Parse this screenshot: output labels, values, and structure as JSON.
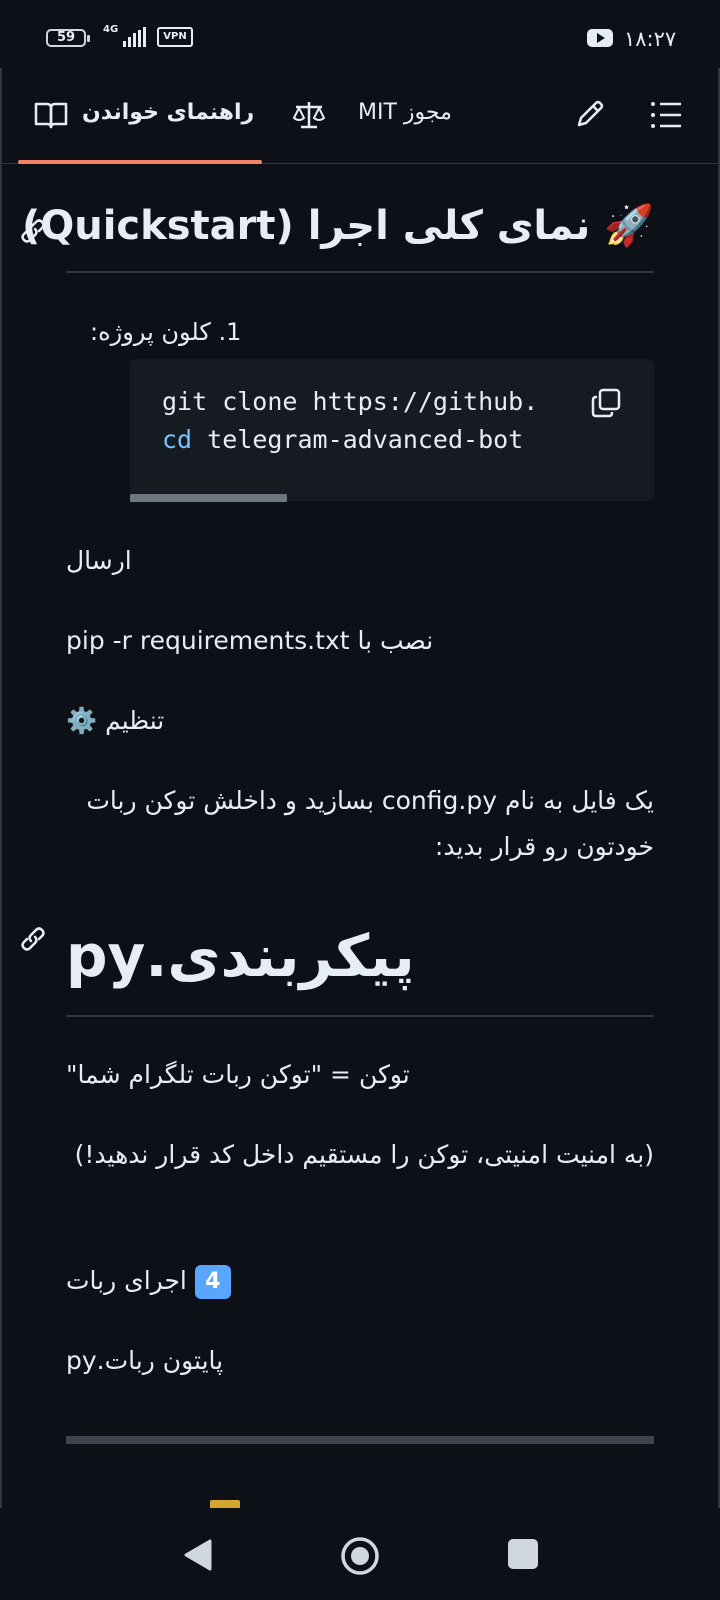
{
  "status_bar": {
    "battery": "59",
    "network": "4G",
    "vpn": "VPN",
    "time": "۱۸:۲۷"
  },
  "tabs": [
    {
      "label": "راهنمای خواندن",
      "icon": "book-icon",
      "active": true
    },
    {
      "label": "مجوز MIT",
      "icon": "scale-icon",
      "active": false
    }
  ],
  "toolbar": {
    "edit_icon": "pencil-icon",
    "outline_icon": "list-icon"
  },
  "content": {
    "heading1": "🚀 نمای کلی اجرا (Quickstart)",
    "step1": "کلون پروژه:",
    "step1_number": "1.",
    "code": {
      "line1": "git clone https://github.",
      "line2_kw": "cd",
      "line2_rest": " telegram-advanced-bot"
    },
    "p1": "ارسال",
    "p2": "نصب با pip -r requirements.txt",
    "p3": "تنظیم ⚙️",
    "p4": "یک فایل به نام config.py بسازید و داخلش توکن ربات خودتون رو قرار بدید:",
    "heading2": "پیکربندی.py",
    "p5": "توکن = \"توکن ربات تلگرام شما\"",
    "p6": "(به امنیت امنیتی، توکن را مستقیم داخل کد قرار ندهید!)",
    "p7_key": "4",
    "p7": "اجرای ربات",
    "p8": "پایتون ربات.py"
  },
  "colors": {
    "accent": "#f78166",
    "background": "#0d1117",
    "code_bg": "#161b22",
    "keyword": "#79c0ff"
  }
}
